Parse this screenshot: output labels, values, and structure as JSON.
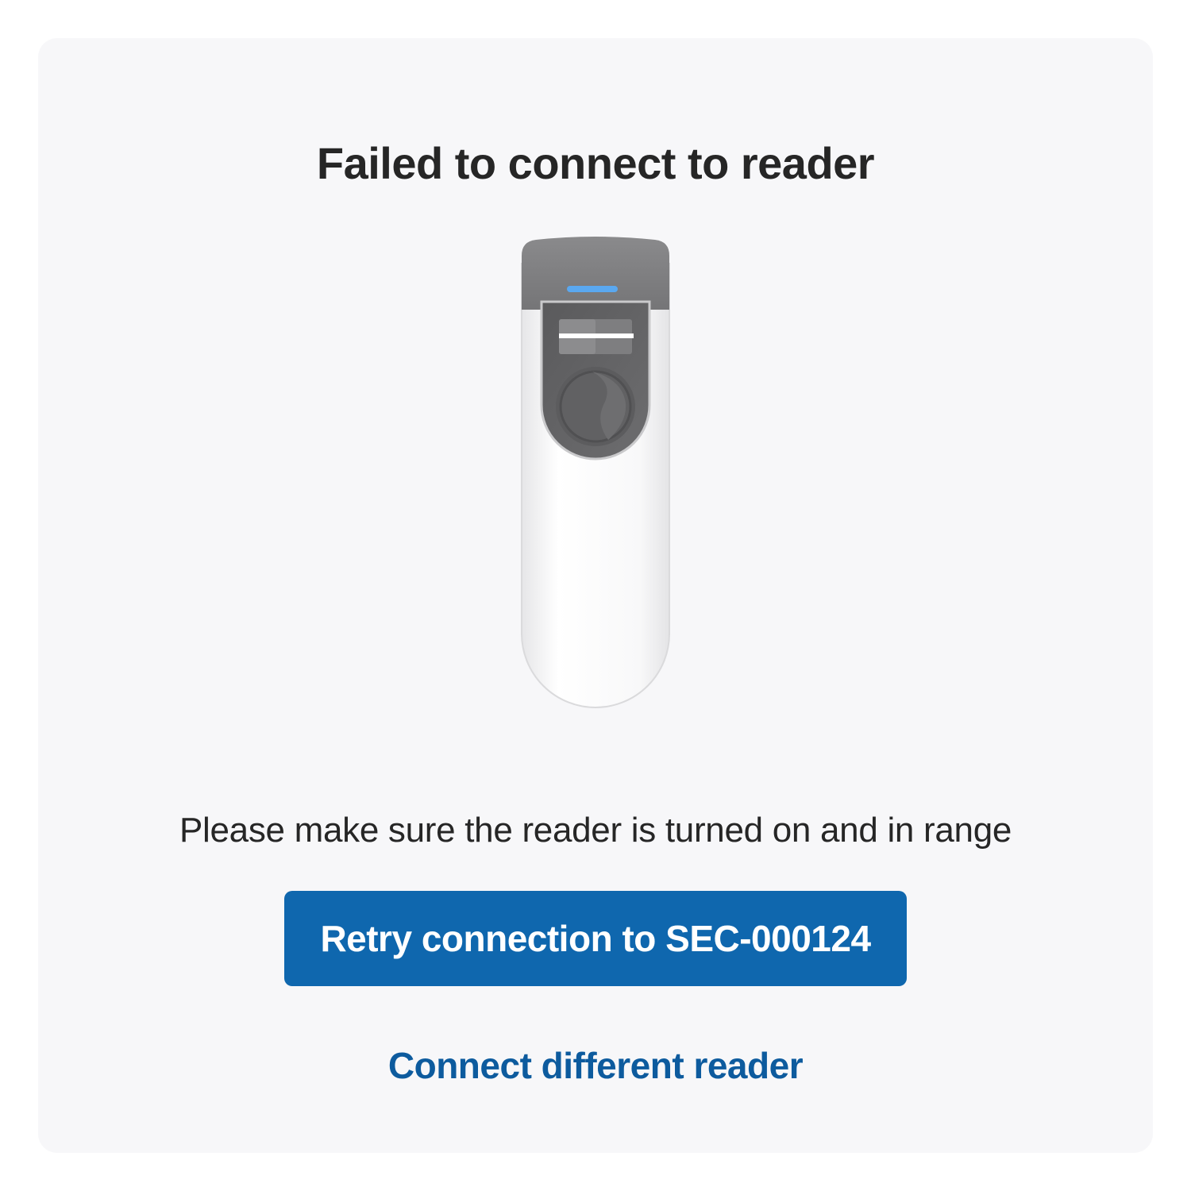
{
  "dialog": {
    "title": "Failed to connect to reader",
    "message": "Please make sure the reader is turned on and in range",
    "retry_button_label": "Retry connection to SEC-000124",
    "connect_different_label": "Connect different reader"
  },
  "device_illustration": {
    "icon": "card-reader-icon",
    "status_light_color": "#5aa8f0"
  },
  "colors": {
    "primary": "#0f67ae",
    "link": "#0d5b9e",
    "card_background": "#f7f7f9",
    "text": "#262626"
  }
}
